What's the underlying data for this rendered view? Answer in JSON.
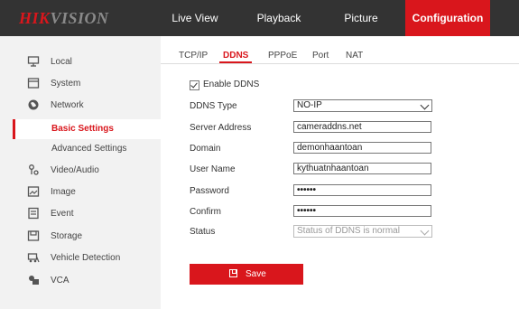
{
  "brand": {
    "part1": "HIK",
    "part2": "VISION"
  },
  "nav": {
    "items": [
      {
        "label": "Live View"
      },
      {
        "label": "Playback"
      },
      {
        "label": "Picture"
      },
      {
        "label": "Configuration",
        "active": true
      }
    ]
  },
  "sidebar": {
    "items": [
      {
        "label": "Local",
        "icon": "monitor-icon"
      },
      {
        "label": "System",
        "icon": "window-icon"
      },
      {
        "label": "Network",
        "icon": "globe-icon"
      },
      {
        "label": "Basic Settings",
        "active": true
      },
      {
        "label": "Advanced Settings"
      },
      {
        "label": "Video/Audio",
        "icon": "video-audio-icon"
      },
      {
        "label": "Image",
        "icon": "image-icon"
      },
      {
        "label": "Event",
        "icon": "event-icon"
      },
      {
        "label": "Storage",
        "icon": "storage-icon"
      },
      {
        "label": "Vehicle Detection",
        "icon": "vehicle-detection-icon"
      },
      {
        "label": "VCA",
        "icon": "vca-icon"
      }
    ]
  },
  "tabs": [
    {
      "label": "TCP/IP"
    },
    {
      "label": "DDNS",
      "active": true
    },
    {
      "label": "PPPoE"
    },
    {
      "label": "Port"
    },
    {
      "label": "NAT"
    }
  ],
  "form": {
    "enable_label": "Enable DDNS",
    "enable_checked": true,
    "ddns_type_label": "DDNS Type",
    "ddns_type_value": "NO-IP",
    "server_address_label": "Server Address",
    "server_address_value": "cameraddns.net",
    "domain_label": "Domain",
    "domain_value": "demonhaantoan",
    "user_name_label": "User Name",
    "user_name_value": "kythuatnhaantoan",
    "password_label": "Password",
    "password_value": "••••••",
    "confirm_label": "Confirm",
    "confirm_value": "••••••",
    "status_label": "Status",
    "status_value": "Status of DDNS is normal"
  },
  "save_button": {
    "label": "Save",
    "icon": "save-icon"
  },
  "colors": {
    "accent": "#d9161c",
    "topbar": "#333333",
    "sidebar": "#f2f2f2"
  }
}
